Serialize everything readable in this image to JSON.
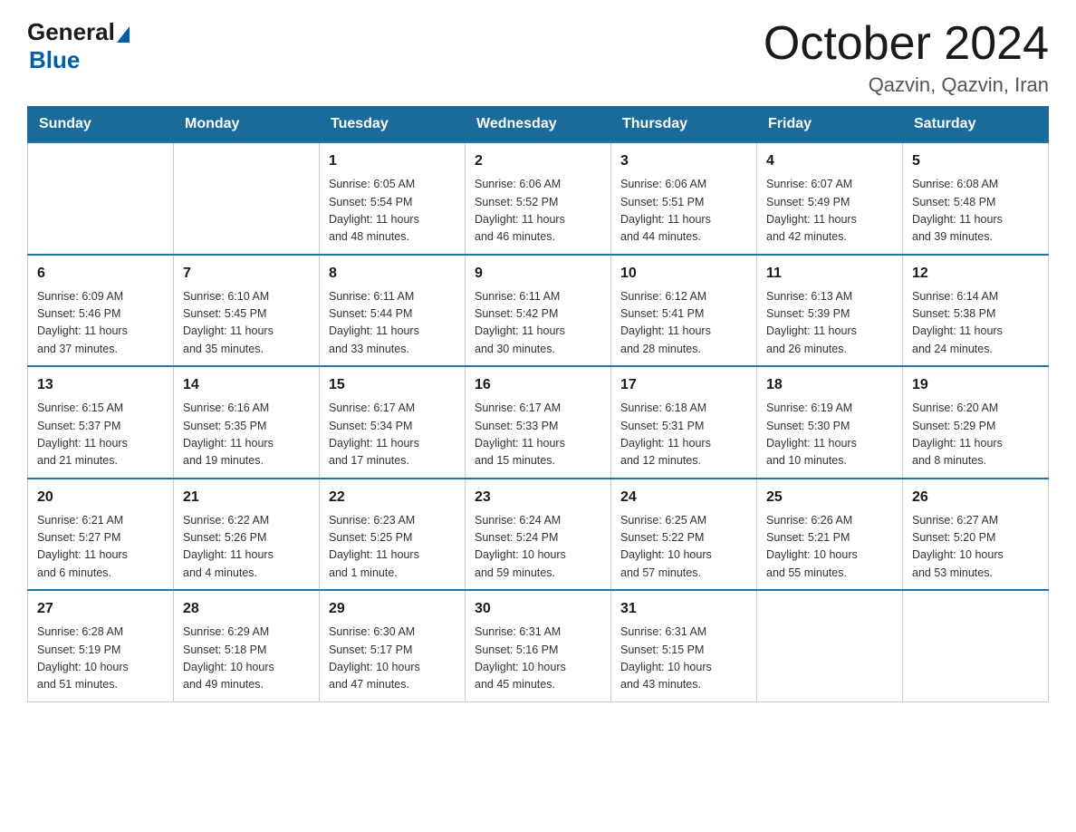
{
  "logo": {
    "general": "General",
    "blue": "Blue"
  },
  "title": "October 2024",
  "subtitle": "Qazvin, Qazvin, Iran",
  "days_of_week": [
    "Sunday",
    "Monday",
    "Tuesday",
    "Wednesday",
    "Thursday",
    "Friday",
    "Saturday"
  ],
  "weeks": [
    [
      {
        "day": "",
        "info": ""
      },
      {
        "day": "",
        "info": ""
      },
      {
        "day": "1",
        "info": "Sunrise: 6:05 AM\nSunset: 5:54 PM\nDaylight: 11 hours\nand 48 minutes."
      },
      {
        "day": "2",
        "info": "Sunrise: 6:06 AM\nSunset: 5:52 PM\nDaylight: 11 hours\nand 46 minutes."
      },
      {
        "day": "3",
        "info": "Sunrise: 6:06 AM\nSunset: 5:51 PM\nDaylight: 11 hours\nand 44 minutes."
      },
      {
        "day": "4",
        "info": "Sunrise: 6:07 AM\nSunset: 5:49 PM\nDaylight: 11 hours\nand 42 minutes."
      },
      {
        "day": "5",
        "info": "Sunrise: 6:08 AM\nSunset: 5:48 PM\nDaylight: 11 hours\nand 39 minutes."
      }
    ],
    [
      {
        "day": "6",
        "info": "Sunrise: 6:09 AM\nSunset: 5:46 PM\nDaylight: 11 hours\nand 37 minutes."
      },
      {
        "day": "7",
        "info": "Sunrise: 6:10 AM\nSunset: 5:45 PM\nDaylight: 11 hours\nand 35 minutes."
      },
      {
        "day": "8",
        "info": "Sunrise: 6:11 AM\nSunset: 5:44 PM\nDaylight: 11 hours\nand 33 minutes."
      },
      {
        "day": "9",
        "info": "Sunrise: 6:11 AM\nSunset: 5:42 PM\nDaylight: 11 hours\nand 30 minutes."
      },
      {
        "day": "10",
        "info": "Sunrise: 6:12 AM\nSunset: 5:41 PM\nDaylight: 11 hours\nand 28 minutes."
      },
      {
        "day": "11",
        "info": "Sunrise: 6:13 AM\nSunset: 5:39 PM\nDaylight: 11 hours\nand 26 minutes."
      },
      {
        "day": "12",
        "info": "Sunrise: 6:14 AM\nSunset: 5:38 PM\nDaylight: 11 hours\nand 24 minutes."
      }
    ],
    [
      {
        "day": "13",
        "info": "Sunrise: 6:15 AM\nSunset: 5:37 PM\nDaylight: 11 hours\nand 21 minutes."
      },
      {
        "day": "14",
        "info": "Sunrise: 6:16 AM\nSunset: 5:35 PM\nDaylight: 11 hours\nand 19 minutes."
      },
      {
        "day": "15",
        "info": "Sunrise: 6:17 AM\nSunset: 5:34 PM\nDaylight: 11 hours\nand 17 minutes."
      },
      {
        "day": "16",
        "info": "Sunrise: 6:17 AM\nSunset: 5:33 PM\nDaylight: 11 hours\nand 15 minutes."
      },
      {
        "day": "17",
        "info": "Sunrise: 6:18 AM\nSunset: 5:31 PM\nDaylight: 11 hours\nand 12 minutes."
      },
      {
        "day": "18",
        "info": "Sunrise: 6:19 AM\nSunset: 5:30 PM\nDaylight: 11 hours\nand 10 minutes."
      },
      {
        "day": "19",
        "info": "Sunrise: 6:20 AM\nSunset: 5:29 PM\nDaylight: 11 hours\nand 8 minutes."
      }
    ],
    [
      {
        "day": "20",
        "info": "Sunrise: 6:21 AM\nSunset: 5:27 PM\nDaylight: 11 hours\nand 6 minutes."
      },
      {
        "day": "21",
        "info": "Sunrise: 6:22 AM\nSunset: 5:26 PM\nDaylight: 11 hours\nand 4 minutes."
      },
      {
        "day": "22",
        "info": "Sunrise: 6:23 AM\nSunset: 5:25 PM\nDaylight: 11 hours\nand 1 minute."
      },
      {
        "day": "23",
        "info": "Sunrise: 6:24 AM\nSunset: 5:24 PM\nDaylight: 10 hours\nand 59 minutes."
      },
      {
        "day": "24",
        "info": "Sunrise: 6:25 AM\nSunset: 5:22 PM\nDaylight: 10 hours\nand 57 minutes."
      },
      {
        "day": "25",
        "info": "Sunrise: 6:26 AM\nSunset: 5:21 PM\nDaylight: 10 hours\nand 55 minutes."
      },
      {
        "day": "26",
        "info": "Sunrise: 6:27 AM\nSunset: 5:20 PM\nDaylight: 10 hours\nand 53 minutes."
      }
    ],
    [
      {
        "day": "27",
        "info": "Sunrise: 6:28 AM\nSunset: 5:19 PM\nDaylight: 10 hours\nand 51 minutes."
      },
      {
        "day": "28",
        "info": "Sunrise: 6:29 AM\nSunset: 5:18 PM\nDaylight: 10 hours\nand 49 minutes."
      },
      {
        "day": "29",
        "info": "Sunrise: 6:30 AM\nSunset: 5:17 PM\nDaylight: 10 hours\nand 47 minutes."
      },
      {
        "day": "30",
        "info": "Sunrise: 6:31 AM\nSunset: 5:16 PM\nDaylight: 10 hours\nand 45 minutes."
      },
      {
        "day": "31",
        "info": "Sunrise: 6:31 AM\nSunset: 5:15 PM\nDaylight: 10 hours\nand 43 minutes."
      },
      {
        "day": "",
        "info": ""
      },
      {
        "day": "",
        "info": ""
      }
    ]
  ]
}
